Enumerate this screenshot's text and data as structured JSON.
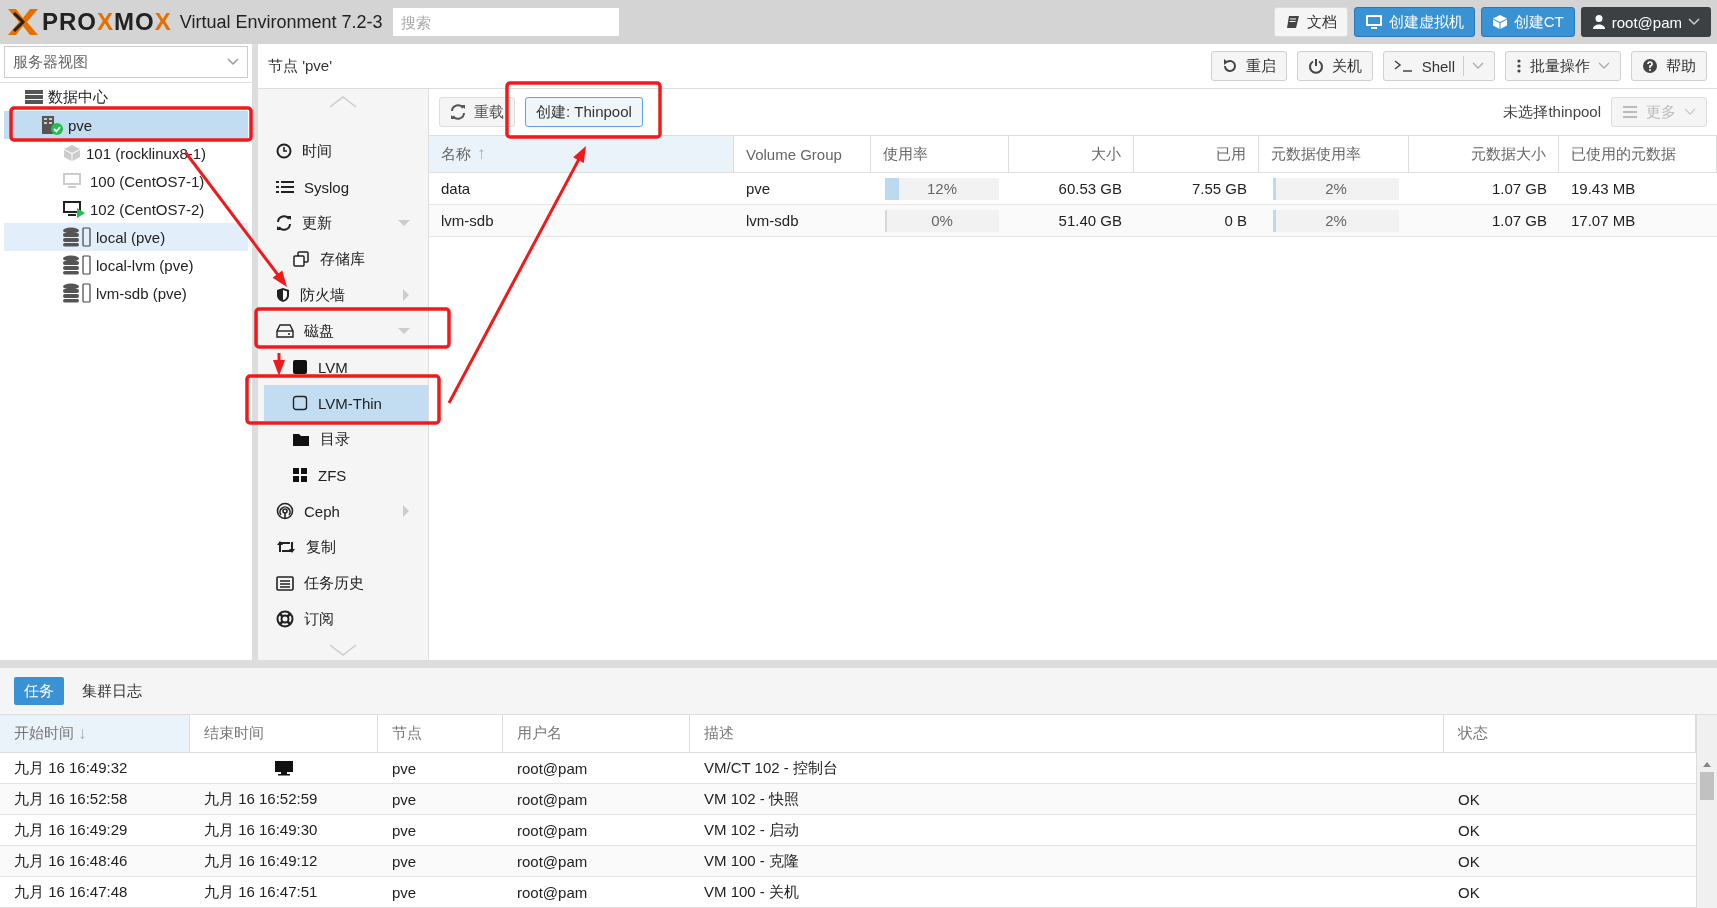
{
  "topbar": {
    "logo": [
      {
        "text": "PRO",
        "accent": false
      },
      {
        "text": "X",
        "accent": true
      },
      {
        "text": "MO",
        "accent": false
      },
      {
        "text": "X",
        "accent": true
      }
    ],
    "product": "Virtual Environment 7.2-3",
    "search": {
      "placeholder": "搜索"
    },
    "buttons": [
      {
        "label": "文档",
        "kind": "plain"
      },
      {
        "label": "创建虚拟机",
        "kind": "primary"
      },
      {
        "label": "创建CT",
        "kind": "primary"
      },
      {
        "label": "root@pam",
        "kind": "user"
      }
    ]
  },
  "sidebar": {
    "view": "服务器视图",
    "tree": [
      {
        "label": "数据中心",
        "kind": "datacenter",
        "selected": false,
        "children": [
          {
            "label": "pve",
            "kind": "node",
            "online": true,
            "selected": true,
            "children": [
              {
                "label": "101 (rocklinux8-1)",
                "kind": "ct",
                "running": false,
                "selected": false
              },
              {
                "label": "100 (CentOS7-1)",
                "kind": "vm",
                "running": false,
                "selected": false
              },
              {
                "label": "102 (CentOS7-2)",
                "kind": "vm",
                "running": true,
                "selected": false
              },
              {
                "label": "local (pve)",
                "kind": "storage",
                "selected": false,
                "hovered": true
              },
              {
                "label": "local-lvm (pve)",
                "kind": "storage",
                "selected": false,
                "hovered": false
              },
              {
                "label": "lvm-sdb (pve)",
                "kind": "storage",
                "selected": false,
                "hovered": false
              }
            ]
          }
        ]
      }
    ]
  },
  "node": {
    "title": "节点 'pve'",
    "buttons": [
      {
        "label": "重启",
        "kind": "plain"
      },
      {
        "label": "关机",
        "kind": "plain"
      },
      {
        "label": "Shell",
        "kind": "split"
      },
      {
        "label": "批量操作",
        "kind": "menu"
      },
      {
        "label": "帮助",
        "kind": "plain"
      }
    ],
    "menu": [
      {
        "label": "时间",
        "selected": false
      },
      {
        "label": "Syslog",
        "selected": false
      },
      {
        "label": "更新",
        "selected": false,
        "expanded": true,
        "children": [
          {
            "label": "存储库",
            "selected": false
          }
        ]
      },
      {
        "label": "防火墙",
        "selected": false,
        "expanded": false
      },
      {
        "label": "磁盘",
        "selected": false,
        "expanded": true,
        "children": [
          {
            "label": "LVM",
            "selected": false
          },
          {
            "label": "LVM-Thin",
            "selected": true
          },
          {
            "label": "目录",
            "selected": false
          },
          {
            "label": "ZFS",
            "selected": false
          }
        ]
      },
      {
        "label": "Ceph",
        "selected": false,
        "expanded": false
      },
      {
        "label": "复制",
        "selected": false
      },
      {
        "label": "任务历史",
        "selected": false
      },
      {
        "label": "订阅",
        "selected": false
      }
    ]
  },
  "content": {
    "toolbar": {
      "reload": "重载",
      "create": "创建: Thinpool",
      "status": "未选择thinpool",
      "more": {
        "label": "更多",
        "disabled": true
      }
    },
    "table": {
      "columns": [
        {
          "label": "名称",
          "sort_mark": "↑"
        },
        {
          "label": "Volume Group"
        },
        {
          "label": "使用率"
        },
        {
          "label": "大小"
        },
        {
          "label": "已用"
        },
        {
          "label": "元数据使用率"
        },
        {
          "label": "元数据大小"
        },
        {
          "label": "已使用的元数据"
        }
      ],
      "rows": [
        {
          "name": "data",
          "vg": "pve",
          "usage": {
            "level": 0.12,
            "text": "12%"
          },
          "size": "60.53 GB",
          "used": "7.55 GB",
          "meta_usage": {
            "level": 0.02,
            "text": "2%"
          },
          "meta_size": "1.07 GB",
          "meta_used": "19.43 MB"
        },
        {
          "name": "lvm-sdb",
          "vg": "lvm-sdb",
          "usage": {
            "level": 0,
            "text": "0%"
          },
          "size": "51.40 GB",
          "used": "0 B",
          "meta_usage": {
            "level": 0.02,
            "text": "2%"
          },
          "meta_size": "1.07 GB",
          "meta_used": "17.07 MB"
        }
      ]
    }
  },
  "tasks": {
    "tabs": [
      {
        "label": "任务",
        "selected": true
      },
      {
        "label": "集群日志",
        "selected": false
      }
    ],
    "columns": [
      {
        "label": "开始时间",
        "sort_mark": "↓"
      },
      {
        "label": "结束时间"
      },
      {
        "label": "节点"
      },
      {
        "label": "用户名"
      },
      {
        "label": "描述"
      },
      {
        "label": "状态"
      }
    ],
    "rows": [
      {
        "start": "九月 16 16:49:32",
        "running": true,
        "node": "pve",
        "user": "root@pam",
        "description": "VM/CT 102 - 控制台"
      },
      {
        "start": "九月 16 16:52:58",
        "end": "九月 16 16:52:59",
        "running": false,
        "node": "pve",
        "user": "root@pam",
        "description": "VM 102 - 快照",
        "status": "OK"
      },
      {
        "start": "九月 16 16:49:29",
        "end": "九月 16 16:49:30",
        "running": false,
        "node": "pve",
        "user": "root@pam",
        "description": "VM 102 - 启动",
        "status": "OK"
      },
      {
        "start": "九月 16 16:48:46",
        "end": "九月 16 16:49:12",
        "running": false,
        "node": "pve",
        "user": "root@pam",
        "description": "VM 100 - 克隆",
        "status": "OK"
      },
      {
        "start": "九月 16 16:47:48",
        "end": "九月 16 16:47:51",
        "running": false,
        "node": "pve",
        "user": "root@pam",
        "description": "VM 100 - 关机",
        "status": "OK"
      }
    ]
  }
}
